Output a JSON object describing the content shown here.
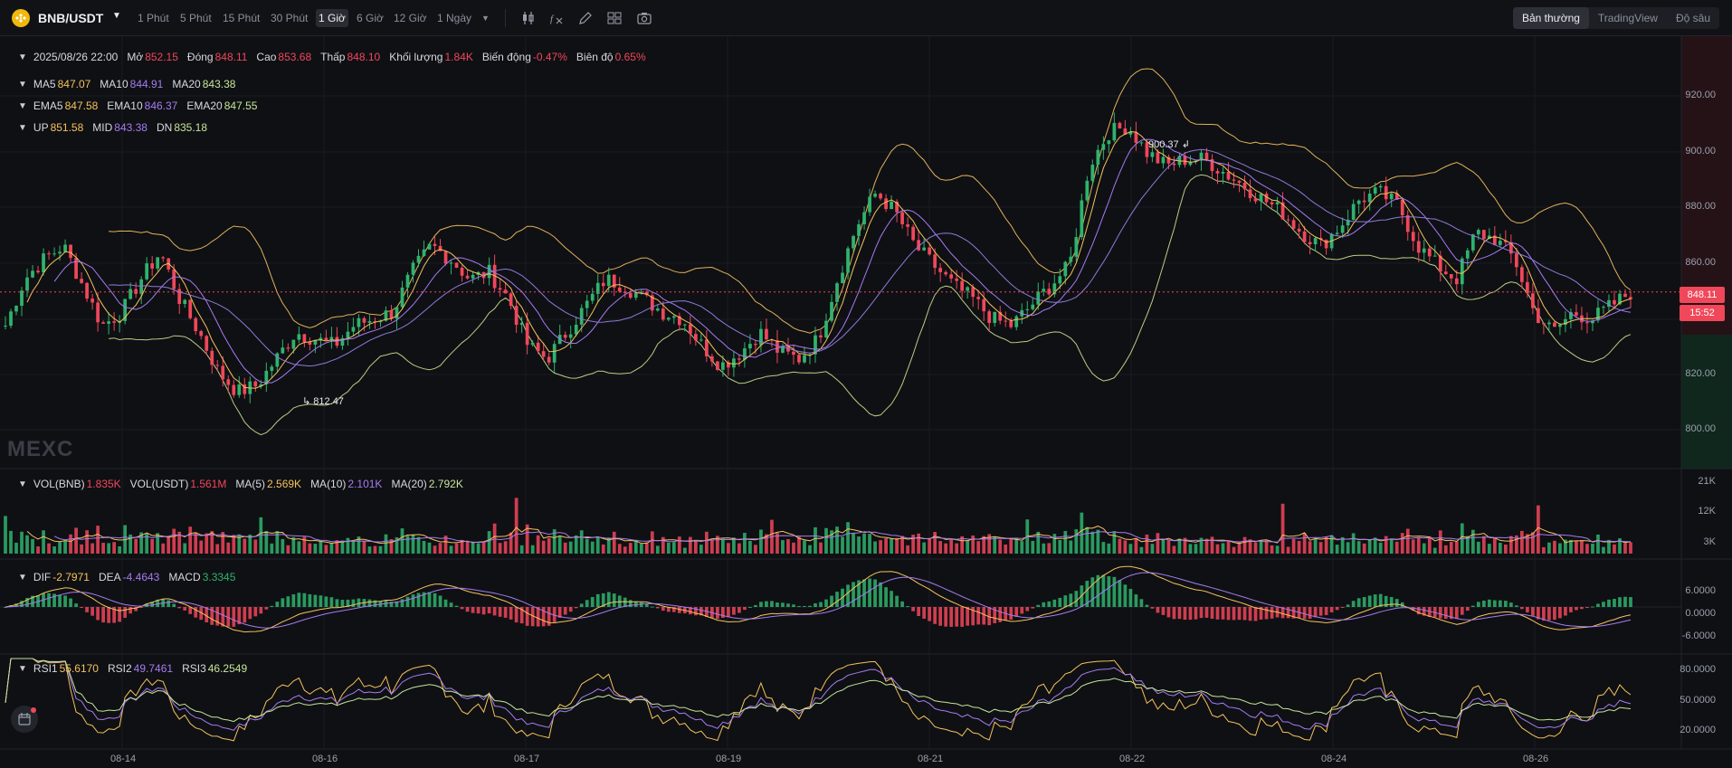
{
  "header": {
    "pair": "BNB/USDT",
    "timeframes": [
      "1 Phút",
      "5 Phút",
      "15 Phút",
      "30 Phút",
      "1 Giờ",
      "6 Giờ",
      "12 Giờ",
      "1 Ngày"
    ],
    "active_timeframe": "1 Giờ",
    "views": [
      "Bản thường",
      "TradingView",
      "Độ sâu"
    ],
    "active_view": "Bản thường",
    "tools": [
      "candle-style-icon",
      "indicator-icon",
      "draw-icon",
      "layout-icon",
      "screenshot-icon"
    ]
  },
  "ohlc": {
    "date": "2025/08/26 22:00",
    "open_label": "Mở",
    "open": "852.15",
    "close_label": "Đóng",
    "close": "848.11",
    "high_label": "Cao",
    "high": "853.68",
    "low_label": "Thấp",
    "low": "848.10",
    "vol_label": "Khối lượng",
    "vol": "1.84K",
    "change_label": "Biến động",
    "change": "-0.47%",
    "amp_label": "Biên độ",
    "amp": "0.65%"
  },
  "ma": {
    "ma5_label": "MA5",
    "ma5": "847.07",
    "ma10_label": "MA10",
    "ma10": "844.91",
    "ma20_label": "MA20",
    "ma20": "843.38"
  },
  "ema": {
    "ema5_label": "EMA5",
    "ema5": "847.58",
    "ema10_label": "EMA10",
    "ema10": "846.37",
    "ema20_label": "EMA20",
    "ema20": "847.55"
  },
  "boll": {
    "up_label": "UP",
    "up": "851.58",
    "mid_label": "MID",
    "mid": "843.38",
    "dn_label": "DN",
    "dn": "835.18"
  },
  "vol_legend": {
    "bnb_label": "VOL(BNB)",
    "bnb": "1.835K",
    "usdt_label": "VOL(USDT)",
    "usdt": "1.561M",
    "ma5_label": "MA(5)",
    "ma5": "2.569K",
    "ma10_label": "MA(10)",
    "ma10": "2.101K",
    "ma20_label": "MA(20)",
    "ma20": "2.792K"
  },
  "macd_legend": {
    "dif_label": "DIF",
    "dif": "-2.7971",
    "dea_label": "DEA",
    "dea": "-4.4643",
    "macd_label": "MACD",
    "macd": "3.3345"
  },
  "rsi_legend": {
    "rsi1_label": "RSI1",
    "rsi1": "55.6170",
    "rsi2_label": "RSI2",
    "rsi2": "49.7461",
    "rsi3_label": "RSI3",
    "rsi3": "46.2549"
  },
  "price_axis": [
    "920.00",
    "900.00",
    "880.00",
    "860.00",
    "840.00",
    "820.00",
    "800.00"
  ],
  "current_price": {
    "value": "848.11",
    "countdown": "15:52"
  },
  "vol_axis": [
    "21K",
    "12K",
    "3K"
  ],
  "macd_axis": [
    "6.0000",
    "0.0000",
    "-6.0000"
  ],
  "rsi_axis": [
    "80.0000",
    "50.0000",
    "20.0000"
  ],
  "date_axis": [
    "08-14",
    "08-16",
    "08-17",
    "08-19",
    "08-21",
    "08-22",
    "08-24",
    "08-26"
  ],
  "annotations": {
    "high": "900.37",
    "low": "812.47"
  },
  "watermark": "MEXC",
  "colors": {
    "up": "#2fb36d",
    "down": "#f0475a",
    "ma5": "#f5c25b",
    "ma10": "#a57cf0",
    "ma20": "#c6e59a",
    "background": "#0f1014"
  },
  "chart_data": {
    "type": "candlestick",
    "x_range": [
      "08-13",
      "08-26 22:00"
    ],
    "price_ylim": [
      795,
      925
    ],
    "close_anchors": [
      838,
      852,
      858,
      862,
      850,
      838,
      842,
      852,
      860,
      846,
      836,
      824,
      818,
      820,
      828,
      836,
      834,
      832,
      838,
      840,
      842,
      854,
      862,
      858,
      852,
      854,
      846,
      832,
      828,
      836,
      844,
      852,
      850,
      846,
      842,
      840,
      832,
      826,
      830,
      836,
      830,
      828,
      834,
      852,
      868,
      878,
      872,
      862,
      856,
      850,
      846,
      840,
      838,
      844,
      850,
      856,
      886,
      896,
      898,
      890,
      886,
      888,
      888,
      884,
      880,
      876,
      872,
      866,
      862,
      868,
      876,
      878,
      874,
      862,
      856,
      852,
      866,
      864,
      858,
      842,
      836,
      842,
      840,
      844,
      848
    ],
    "high_marker": 900.37,
    "low_marker": 812.47
  }
}
